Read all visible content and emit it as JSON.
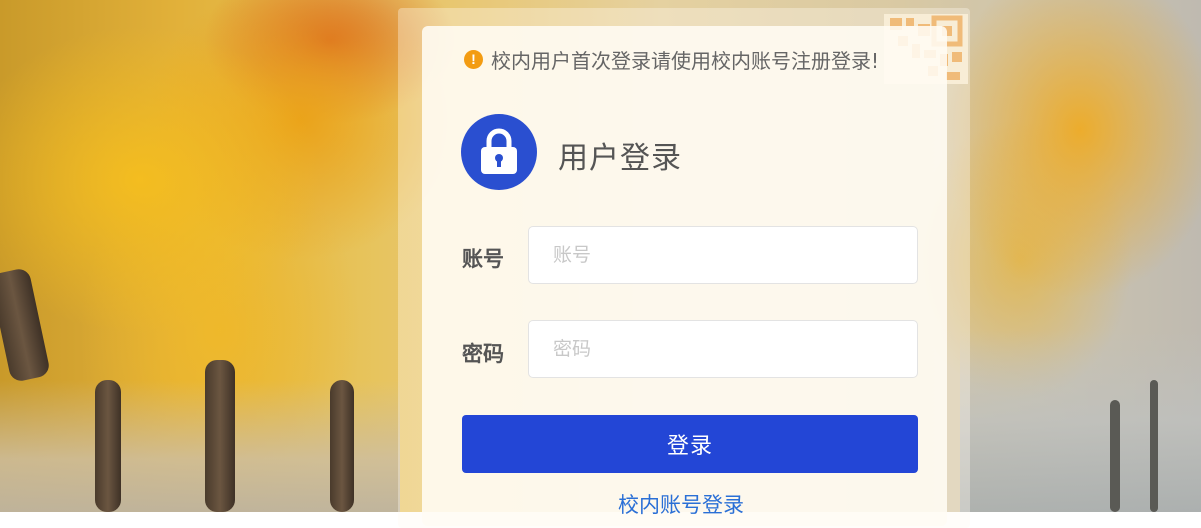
{
  "notice": {
    "icon": "warning-icon",
    "icon_glyph": "!",
    "text": "校内用户首次登录请使用校内账号注册登录!"
  },
  "header": {
    "icon": "lock-icon",
    "title": "用户登录"
  },
  "form": {
    "account": {
      "label": "账号",
      "placeholder": "账号",
      "value": ""
    },
    "password": {
      "label": "密码",
      "placeholder": "密码",
      "value": ""
    },
    "submit_label": "登录",
    "campus_link_label": "校内账号登录"
  },
  "colors": {
    "primary_button": "#2346d6",
    "lock_circle": "#2a4fd0",
    "link": "#2a6fd6",
    "warning": "#f39c12"
  }
}
